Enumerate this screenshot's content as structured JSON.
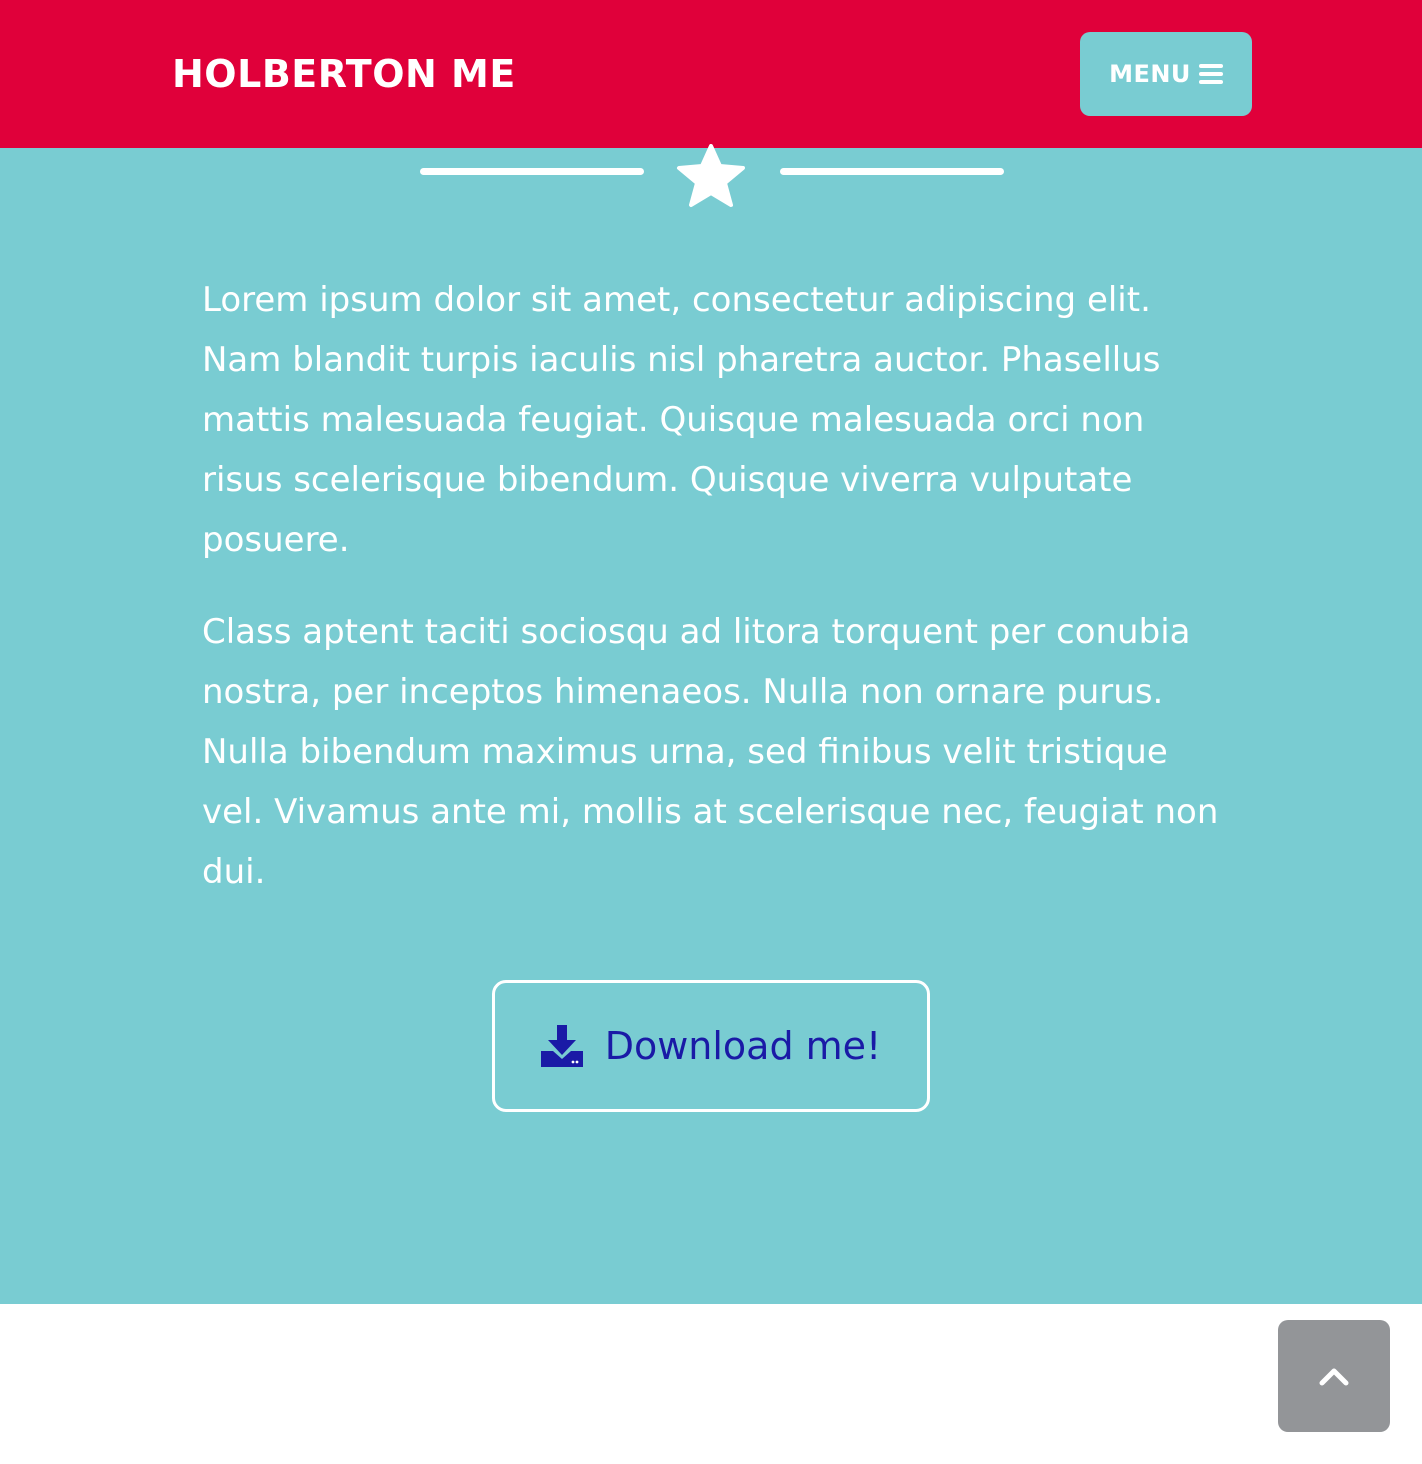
{
  "navbar": {
    "brand": "HOLBERTON ME",
    "menu_label": "MENU",
    "menu_icon": "bars-icon"
  },
  "about": {
    "divider_icon": "star-icon",
    "paragraphs": [
      "Lorem ipsum dolor sit amet, consectetur adipiscing elit. Nam blandit turpis iaculis nisl pharetra auctor. Phasellus mattis malesuada feugiat. Quisque malesuada orci non risus scelerisque bibendum. Quisque viverra vulputate posuere.",
      "Class aptent taciti sociosqu ad litora torquent per conubia nostra, per inceptos himenaeos. Nulla non ornare purus. Nulla bibendum maximus urna, sed finibus velit tristique vel. Vivamus ante mi, mollis at scelerisque nec, feugiat non dui."
    ],
    "download": {
      "label": "Download me!",
      "icon": "download-icon"
    }
  },
  "scroll_top": {
    "icon": "chevron-up-icon"
  },
  "colors": {
    "navbar_bg": "#e0003a",
    "section_bg": "#79ccd2",
    "download_text": "#1a1aa6",
    "scroll_top_bg": "#939598"
  }
}
